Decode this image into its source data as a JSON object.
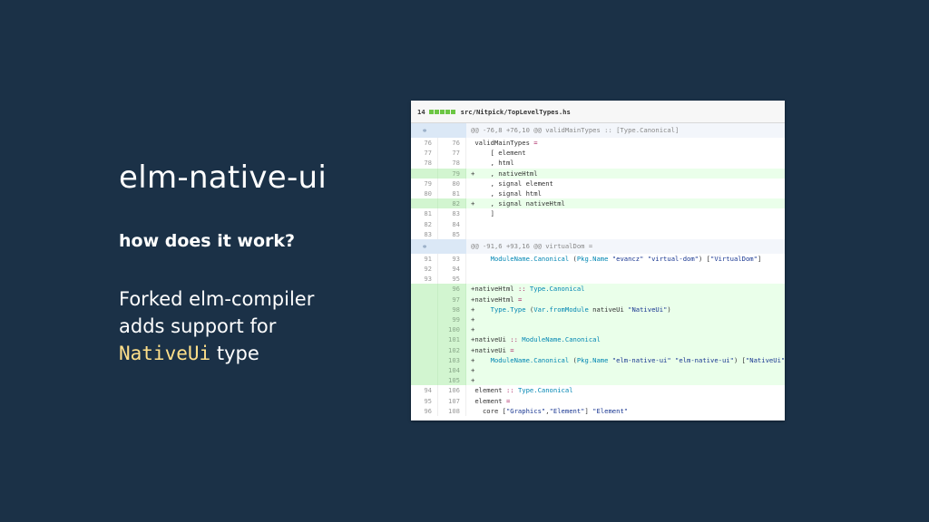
{
  "slide": {
    "title": "elm-native-ui",
    "subtitle": "how does it work?",
    "line1": "Forked elm-compiler",
    "line2": "adds support for",
    "code_word": "NativeUi",
    "type_word": "type"
  },
  "diff": {
    "count": "14",
    "path": "src/Nitpick/TopLevelTypes.hs",
    "hunk1": "@@ -76,8 +76,10 @@ validMainTypes :: [Type.Canonical]",
    "hunk2": "@@ -91,6 +93,16 @@ virtualDom =",
    "rows1": [
      {
        "old": "76",
        "new": "76",
        "type": "ctx",
        "code": " validMainTypes ="
      },
      {
        "old": "77",
        "new": "77",
        "type": "ctx",
        "code": "     [ element"
      },
      {
        "old": "78",
        "new": "78",
        "type": "ctx",
        "code": "     , html"
      },
      {
        "old": "",
        "new": "79",
        "type": "add",
        "code": "+    , nativeHtml"
      },
      {
        "old": "79",
        "new": "80",
        "type": "ctx",
        "code": "     , signal element"
      },
      {
        "old": "80",
        "new": "81",
        "type": "ctx",
        "code": "     , signal html"
      },
      {
        "old": "",
        "new": "82",
        "type": "add",
        "code": "+    , signal nativeHtml"
      },
      {
        "old": "81",
        "new": "83",
        "type": "ctx",
        "code": "     ]"
      },
      {
        "old": "82",
        "new": "84",
        "type": "ctx",
        "code": ""
      },
      {
        "old": "83",
        "new": "85",
        "type": "ctx",
        "code": ""
      }
    ],
    "rows2": [
      {
        "old": "91",
        "new": "93",
        "type": "ctx",
        "code": "     ModuleName.Canonical (Pkg.Name \"evancz\" \"virtual-dom\") [\"VirtualDom\"]"
      },
      {
        "old": "92",
        "new": "94",
        "type": "ctx",
        "code": ""
      },
      {
        "old": "93",
        "new": "95",
        "type": "ctx",
        "code": ""
      },
      {
        "old": "",
        "new": "96",
        "type": "add",
        "code": "+nativeHtml :: Type.Canonical"
      },
      {
        "old": "",
        "new": "97",
        "type": "add",
        "code": "+nativeHtml ="
      },
      {
        "old": "",
        "new": "98",
        "type": "add",
        "code": "+    Type.Type (Var.fromModule nativeUi \"NativeUi\")"
      },
      {
        "old": "",
        "new": "99",
        "type": "add",
        "code": "+"
      },
      {
        "old": "",
        "new": "100",
        "type": "add",
        "code": "+"
      },
      {
        "old": "",
        "new": "101",
        "type": "add",
        "code": "+nativeUi :: ModuleName.Canonical"
      },
      {
        "old": "",
        "new": "102",
        "type": "add",
        "code": "+nativeUi ="
      },
      {
        "old": "",
        "new": "103",
        "type": "add",
        "code": "+    ModuleName.Canonical (Pkg.Name \"elm-native-ui\" \"elm-native-ui\") [\"NativeUi\"]"
      },
      {
        "old": "",
        "new": "104",
        "type": "add",
        "code": "+"
      },
      {
        "old": "",
        "new": "105",
        "type": "add",
        "code": "+"
      },
      {
        "old": "94",
        "new": "106",
        "type": "ctx",
        "code": " element :: Type.Canonical"
      },
      {
        "old": "95",
        "new": "107",
        "type": "ctx",
        "code": " element ="
      },
      {
        "old": "96",
        "new": "108",
        "type": "ctx",
        "code": "   core [\"Graphics\",\"Element\"] \"Element\""
      }
    ],
    "colors": {
      "add_bg": "#eaffea",
      "add_gutter": "#d2f5d0",
      "hunk_bg": "#f3f6fb",
      "bar": "#6cc644"
    }
  }
}
